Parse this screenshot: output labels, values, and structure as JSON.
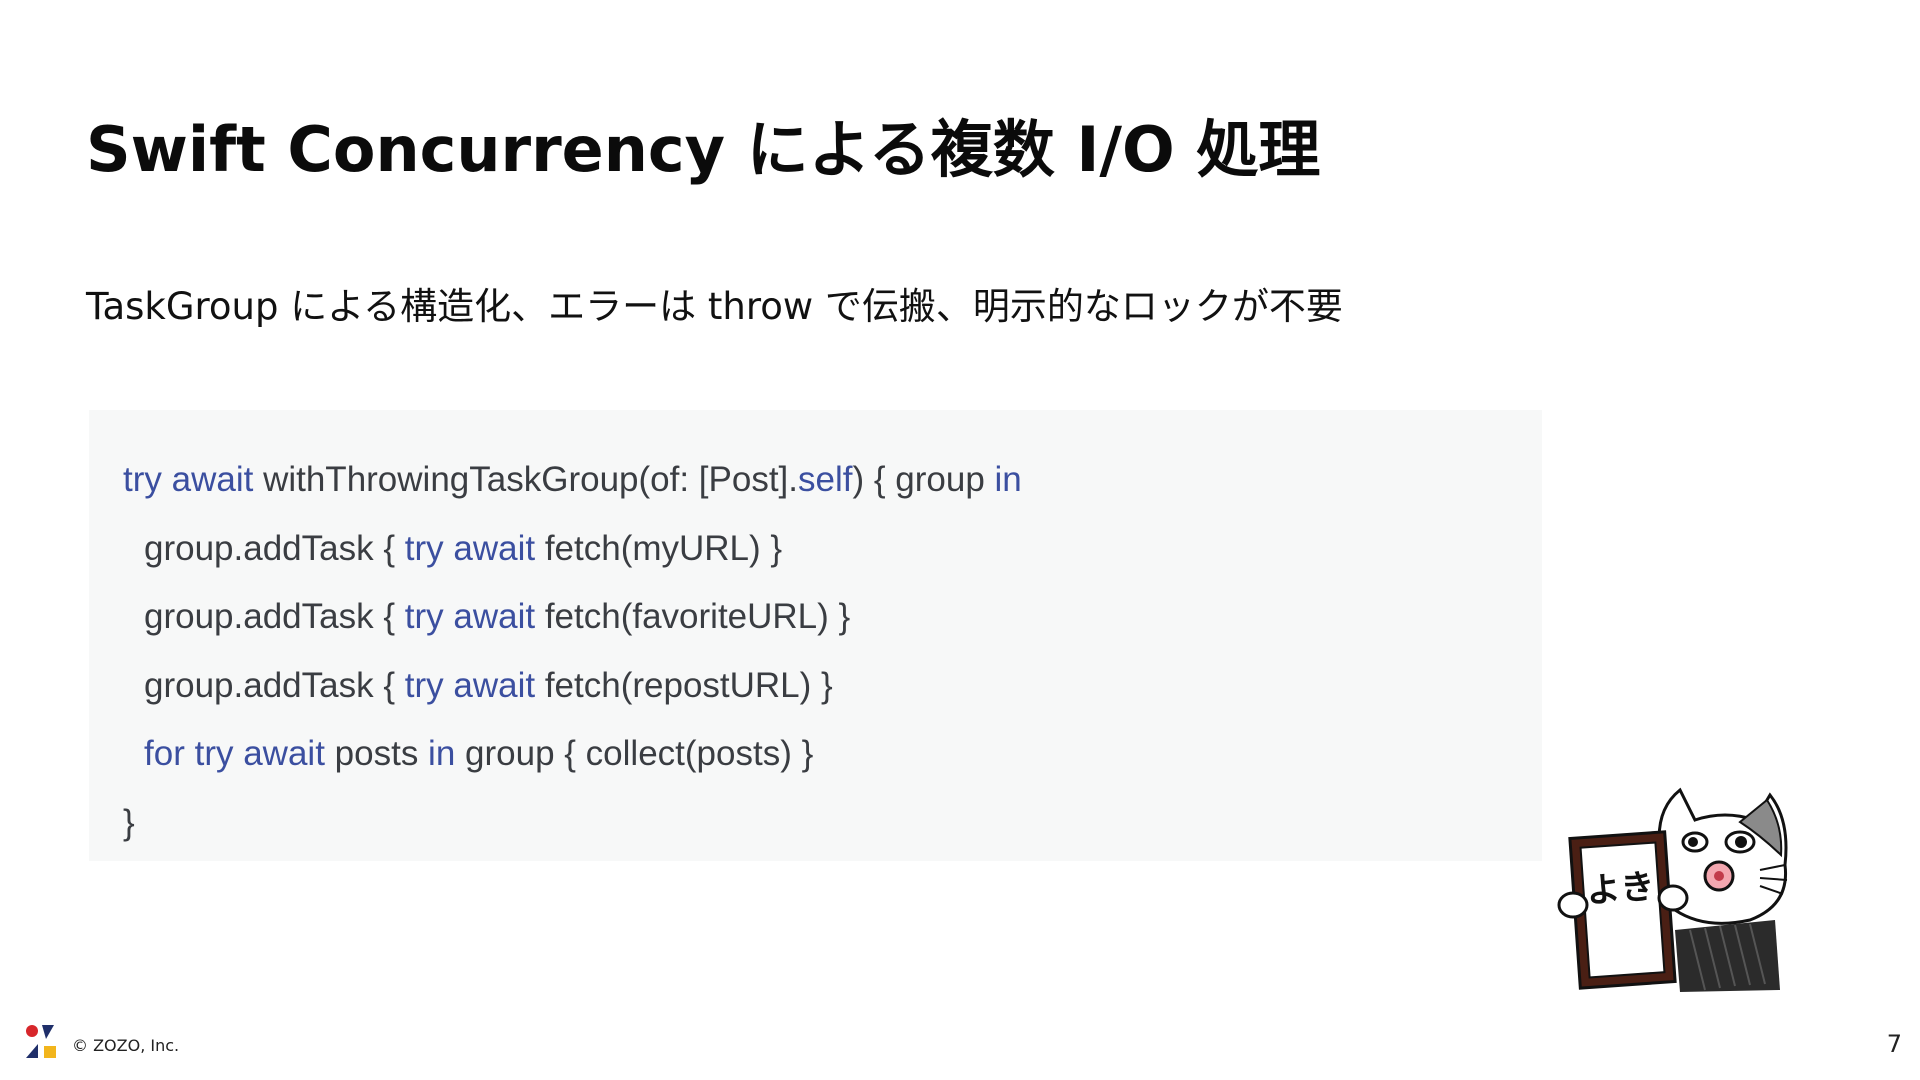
{
  "slide": {
    "title": "Swift Concurrency による複数 I/O 処理",
    "subtitle": "TaskGroup による構造化、エラーは throw で伝搬、明示的なロックが不要",
    "page_number": "7"
  },
  "code": {
    "keyword_color": "#3b4fa0",
    "text_color": "#3a3d42",
    "background": "#f7f8f8",
    "lines": [
      {
        "indent": false,
        "tokens": [
          {
            "t": "try",
            "kw": true
          },
          {
            "t": " "
          },
          {
            "t": "await",
            "kw": true
          },
          {
            "t": " withThrowingTaskGroup(of: [Post]."
          },
          {
            "t": "self",
            "kw": true
          },
          {
            "t": ") { group "
          },
          {
            "t": "in",
            "kw": true
          }
        ]
      },
      {
        "indent": true,
        "tokens": [
          {
            "t": "group.addTask { "
          },
          {
            "t": "try",
            "kw": true
          },
          {
            "t": " "
          },
          {
            "t": "await",
            "kw": true
          },
          {
            "t": " fetch(myURL) }"
          }
        ]
      },
      {
        "indent": true,
        "tokens": [
          {
            "t": "group.addTask { "
          },
          {
            "t": "try",
            "kw": true
          },
          {
            "t": " "
          },
          {
            "t": "await",
            "kw": true
          },
          {
            "t": " fetch(favoriteURL) }"
          }
        ]
      },
      {
        "indent": true,
        "tokens": [
          {
            "t": "group.addTask { "
          },
          {
            "t": "try",
            "kw": true
          },
          {
            "t": " "
          },
          {
            "t": "await",
            "kw": true
          },
          {
            "t": " fetch(repostURL) }"
          }
        ]
      },
      {
        "indent": true,
        "tokens": [
          {
            "t": "for",
            "kw": true
          },
          {
            "t": " "
          },
          {
            "t": "try",
            "kw": true
          },
          {
            "t": " "
          },
          {
            "t": "await",
            "kw": true
          },
          {
            "t": " posts "
          },
          {
            "t": "in",
            "kw": true
          },
          {
            "t": " group { collect(posts) }"
          }
        ]
      },
      {
        "indent": false,
        "tokens": [
          {
            "t": "}"
          }
        ]
      }
    ]
  },
  "footer": {
    "copyright": "© ZOZO, Inc.",
    "logo_icon": "zozo-logo-icon",
    "logo_colors": {
      "red": "#d7262b",
      "navy": "#1f2f6a",
      "yellow": "#f2b51c"
    }
  },
  "mascot": {
    "icon": "cat-mascot-holding-sign-icon",
    "sign_text": "よき"
  }
}
